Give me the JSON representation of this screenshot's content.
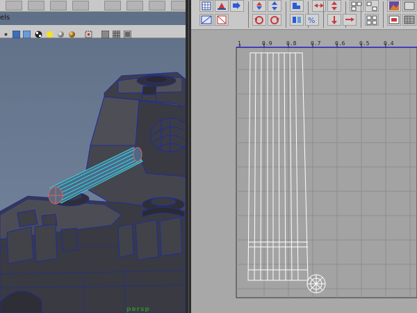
{
  "left_viewport": {
    "panel_menu_label": "els",
    "camera_label": "persp"
  },
  "uv_editor": {
    "ruler_ticks": [
      "1",
      "0.9",
      "0.8",
      "0.7",
      "0.6",
      "0.5",
      "0.4"
    ]
  },
  "colors": {
    "viewport_bg": "#6b7c94",
    "wireframe": "#1e2d9a",
    "selection": "#38d8d8",
    "uv_grid": "#8e8e8e",
    "uv_shell": "#ffffff",
    "ruler_line": "#1c1cc8",
    "camera_label": "#2e8d2e"
  },
  "icons": {
    "left_toolbar": [
      "camera-select-icon",
      "camera-attr-icon",
      "bookmark-icon",
      "grid-icon",
      "smooth-shade-icon",
      "textured-icon",
      "lights-icon",
      "wireframe-on-shaded-icon",
      "xray-icon",
      "isolate-icon",
      "hud-icon"
    ],
    "uv_toolbar": [
      "uv-grid-icon",
      "uv-flip-icon",
      "move-uv-icon",
      "rotate-uv-icon",
      "unfold-icon",
      "cut-uv-icon",
      "sew-uv-icon",
      "align-left-icon",
      "align-right-icon",
      "snapshot-icon",
      "texture-icon",
      "isolate-uv-icon"
    ]
  }
}
